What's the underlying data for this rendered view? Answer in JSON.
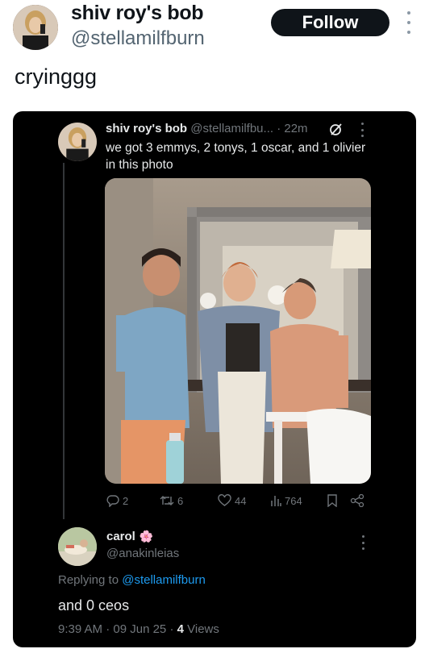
{
  "tweet": {
    "display_name": "shiv roy's bob",
    "handle": "@stellamilfburn",
    "follow_label": "Follow",
    "text": "cryinggg"
  },
  "quoted": {
    "display_name": "shiv roy's bob",
    "handle_truncated": "@stellamilfbu...",
    "separator": "·",
    "time": "22m",
    "text": "we got 3 emmys, 2 tonys, 1 oscar, and 1 olivier in this photo",
    "actions": {
      "replies": "2",
      "retweets": "6",
      "likes": "44",
      "views": "764"
    }
  },
  "reply": {
    "display_name": "carol",
    "name_emoji": "🌸",
    "handle": "@anakinleias",
    "replying_prefix": "Replying to",
    "replying_to": "@stellamilfburn",
    "text": "and 0 ceos",
    "time": "9:39 AM",
    "date": "09 Jun 25",
    "view_count": "4",
    "views_label": "Views",
    "dot": "·"
  },
  "colors": {
    "link": "#1d9bf0",
    "card_bg": "#000000",
    "muted": "#71767b"
  },
  "icons": [
    "reply-icon",
    "retweet-icon",
    "like-icon",
    "views-icon",
    "bookmark-icon",
    "share-icon",
    "grok-icon",
    "more-icon"
  ]
}
